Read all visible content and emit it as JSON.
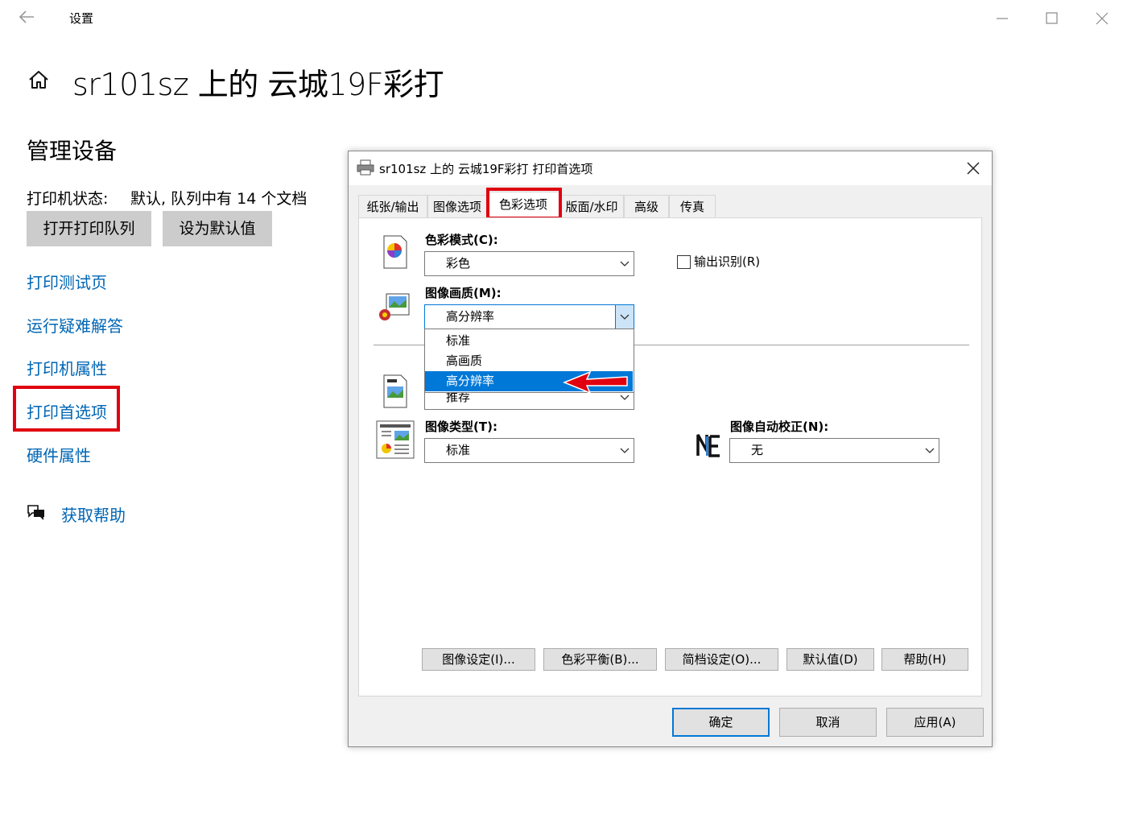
{
  "window": {
    "title": "设置",
    "page_title": "sr101sz 上的 云城19F彩打"
  },
  "manage": {
    "section_title": "管理设备",
    "status_label": "打印机状态:",
    "status_value": "默认, 队列中有 14 个文档",
    "open_queue_button": "打开打印队列",
    "set_default_button": "设为默认值",
    "links": [
      "打印测试页",
      "运行疑难解答",
      "打印机属性",
      "打印首选项",
      "硬件属性"
    ],
    "help_link": "获取帮助"
  },
  "dialog": {
    "title": "sr101sz 上的 云城19F彩打 打印首选项",
    "tabs": [
      "纸张/输出",
      "图像选项",
      "色彩选项",
      "版面/水印",
      "高级",
      "传真"
    ],
    "color_mode_label": "色彩模式(C):",
    "color_mode_value": "彩色",
    "output_id_label": "输出识别(R)",
    "image_quality_label": "图像画质(M):",
    "image_quality_value": "高分辨率",
    "image_quality_options": [
      "标准",
      "高画质",
      "高分辨率"
    ],
    "hidden_combo_value": "推荐",
    "image_type_label": "图像类型(T):",
    "image_type_value": "标准",
    "auto_correct_label": "图像自动校正(N):",
    "auto_correct_value": "无",
    "bottom_buttons": [
      "图像设定(I)...",
      "色彩平衡(B)...",
      "简档设定(O)...",
      "默认值(D)",
      "帮助(H)"
    ],
    "ok_button": "确定",
    "cancel_button": "取消",
    "apply_button": "应用(A)"
  },
  "colors": {
    "link": "#0066b4",
    "highlight": "#e0000f",
    "selection": "#0078d7"
  }
}
